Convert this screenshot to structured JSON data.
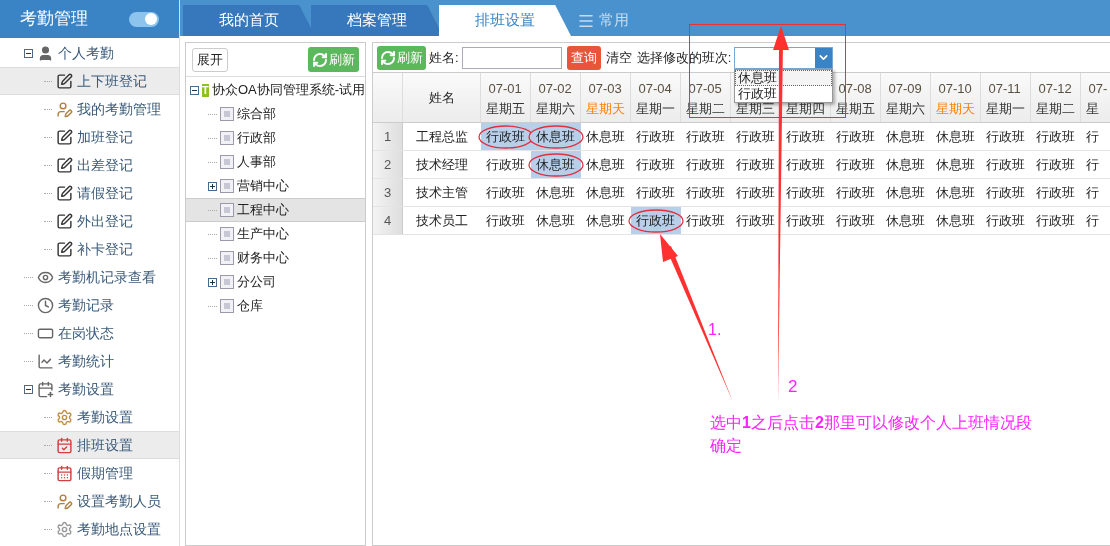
{
  "sidebar": {
    "title": "考勤管理",
    "toggle_on": true,
    "items": [
      {
        "label": "个人考勤",
        "kind": "user",
        "expanded": true,
        "selected": false,
        "children": [
          {
            "label": "上下班登记",
            "kind": "edit",
            "selected": true
          },
          {
            "label": "我的考勤管理",
            "kind": "user-edit",
            "selected": false
          },
          {
            "label": "加班登记",
            "kind": "edit",
            "selected": false
          },
          {
            "label": "出差登记",
            "kind": "edit",
            "selected": false
          },
          {
            "label": "请假登记",
            "kind": "edit",
            "selected": false
          },
          {
            "label": "外出登记",
            "kind": "edit",
            "selected": false
          },
          {
            "label": "补卡登记",
            "kind": "edit",
            "selected": false
          }
        ]
      },
      {
        "label": "考勤机记录查看",
        "kind": "eye",
        "selected": false
      },
      {
        "label": "考勤记录",
        "kind": "clock",
        "selected": false
      },
      {
        "label": "在岗状态",
        "kind": "bar",
        "selected": false
      },
      {
        "label": "考勤统计",
        "kind": "chart",
        "selected": false
      },
      {
        "label": "考勤设置",
        "kind": "calendar",
        "expanded": true,
        "selected": false,
        "children": [
          {
            "label": "考勤设置",
            "kind": "gear-edit",
            "selected": false
          },
          {
            "label": "排班设置",
            "kind": "calendar-edit",
            "selected": true
          },
          {
            "label": "假期管理",
            "kind": "calendar-red",
            "selected": false
          },
          {
            "label": "设置考勤人员",
            "kind": "user-edit",
            "selected": false
          },
          {
            "label": "考勤地点设置",
            "kind": "gear",
            "selected": false
          }
        ]
      }
    ]
  },
  "tabs": [
    {
      "label": "我的首页",
      "kind": "tab",
      "selected": false
    },
    {
      "label": "档案管理",
      "kind": "tab",
      "selected": false
    },
    {
      "label": "排班设置",
      "kind": "tab",
      "selected": true
    },
    {
      "label": "常用",
      "kind": "menu",
      "selected": false
    }
  ],
  "tree_panel": {
    "expand_button": "展开",
    "refresh_button": "刷新",
    "root": {
      "label": "协众OA协同管理系统-试用",
      "logo_letter": "T",
      "expanded": true,
      "children": [
        {
          "label": "综合部",
          "kind": "leaf",
          "selected": false
        },
        {
          "label": "行政部",
          "kind": "leaf",
          "selected": false
        },
        {
          "label": "人事部",
          "kind": "leaf",
          "selected": false
        },
        {
          "label": "营销中心",
          "kind": "group",
          "expanded": false,
          "selected": false
        },
        {
          "label": "工程中心",
          "kind": "leaf",
          "selected": true
        },
        {
          "label": "生产中心",
          "kind": "leaf",
          "selected": false
        },
        {
          "label": "财务中心",
          "kind": "leaf",
          "selected": false
        },
        {
          "label": "分公司",
          "kind": "group",
          "expanded": false,
          "selected": false
        },
        {
          "label": "仓库",
          "kind": "leaf",
          "selected": false
        }
      ]
    }
  },
  "toolbar": {
    "refresh_button": "刷新",
    "name_label": "姓名:",
    "search_button": "查询",
    "clear_link": "清空",
    "shift_label": "选择修改的班次:",
    "shift_options": [
      {
        "label": "休息班",
        "selected": true
      },
      {
        "label": "行政班",
        "selected": false
      }
    ]
  },
  "table": {
    "name_header": "姓名",
    "columns": [
      {
        "date": "07-01",
        "weekday": "星期五",
        "color": "#333333"
      },
      {
        "date": "07-02",
        "weekday": "星期六",
        "color": "#333333"
      },
      {
        "date": "07-03",
        "weekday": "星期天",
        "color": "#ff8000"
      },
      {
        "date": "07-04",
        "weekday": "星期一",
        "color": "#333333"
      },
      {
        "date": "07-05",
        "weekday": "星期二",
        "color": "#333333"
      },
      {
        "weekday": "星期三",
        "color": "#333333"
      },
      {
        "weekday": "星期四",
        "color": "#333333"
      },
      {
        "date": "07-08",
        "weekday": "星期五",
        "color": "#333333"
      },
      {
        "date": "07-09",
        "weekday": "星期六",
        "color": "#333333"
      },
      {
        "date": "07-10",
        "weekday": "星期天",
        "color": "#ff8000"
      },
      {
        "date": "07-11",
        "weekday": "星期一",
        "color": "#333333"
      },
      {
        "date": "07-12",
        "weekday": "星期二",
        "color": "#333333"
      },
      {
        "date": "07-",
        "weekday": "星",
        "color": "#333333"
      }
    ],
    "rows": [
      {
        "number": "1",
        "name": "工程总监",
        "cells": [
          {
            "text": "行政班",
            "selected": true
          },
          {
            "text": "休息班",
            "selected": true
          },
          {
            "text": "休息班",
            "selected": false
          },
          {
            "text": "行政班",
            "selected": false
          },
          {
            "text": "行政班",
            "selected": false
          },
          {
            "text": "行政班",
            "selected": false
          },
          {
            "text": "行政班",
            "selected": false
          },
          {
            "text": "行政班",
            "selected": false
          },
          {
            "text": "休息班",
            "selected": false
          },
          {
            "text": "休息班",
            "selected": false
          },
          {
            "text": "行政班",
            "selected": false
          },
          {
            "text": "行政班",
            "selected": false
          },
          {
            "text": "行",
            "selected": false
          }
        ]
      },
      {
        "number": "2",
        "name": "技术经理",
        "cells": [
          {
            "text": "行政班",
            "selected": false
          },
          {
            "text": "休息班",
            "selected": true
          },
          {
            "text": "休息班",
            "selected": false
          },
          {
            "text": "行政班",
            "selected": false
          },
          {
            "text": "行政班",
            "selected": false
          },
          {
            "text": "行政班",
            "selected": false
          },
          {
            "text": "行政班",
            "selected": false
          },
          {
            "text": "行政班",
            "selected": false
          },
          {
            "text": "休息班",
            "selected": false
          },
          {
            "text": "休息班",
            "selected": false
          },
          {
            "text": "行政班",
            "selected": false
          },
          {
            "text": "行政班",
            "selected": false
          },
          {
            "text": "行",
            "selected": false
          }
        ]
      },
      {
        "number": "3",
        "name": "技术主管",
        "cells": [
          {
            "text": "行政班",
            "selected": false
          },
          {
            "text": "休息班",
            "selected": false
          },
          {
            "text": "休息班",
            "selected": false
          },
          {
            "text": "行政班",
            "selected": false
          },
          {
            "text": "行政班",
            "selected": false
          },
          {
            "text": "行政班",
            "selected": false
          },
          {
            "text": "行政班",
            "selected": false
          },
          {
            "text": "行政班",
            "selected": false
          },
          {
            "text": "休息班",
            "selected": false
          },
          {
            "text": "休息班",
            "selected": false
          },
          {
            "text": "行政班",
            "selected": false
          },
          {
            "text": "行政班",
            "selected": false
          },
          {
            "text": "行",
            "selected": false
          }
        ]
      },
      {
        "number": "4",
        "name": "技术员工",
        "cells": [
          {
            "text": "行政班",
            "selected": false
          },
          {
            "text": "休息班",
            "selected": false
          },
          {
            "text": "休息班",
            "selected": false
          },
          {
            "text": "行政班",
            "selected": true
          },
          {
            "text": "行政班",
            "selected": false
          },
          {
            "text": "行政班",
            "selected": false
          },
          {
            "text": "行政班",
            "selected": false
          },
          {
            "text": "行政班",
            "selected": false
          },
          {
            "text": "休息班",
            "selected": false
          },
          {
            "text": "休息班",
            "selected": false
          },
          {
            "text": "行政班",
            "selected": false
          },
          {
            "text": "行政班",
            "selected": false
          },
          {
            "text": "行",
            "selected": false
          }
        ]
      }
    ]
  },
  "annotations": {
    "label_1": "1.",
    "label_2": "2",
    "note": "选中**1**之后点击**2**那里可以修改个人上班情况段",
    "note_line_2": "确定"
  }
}
